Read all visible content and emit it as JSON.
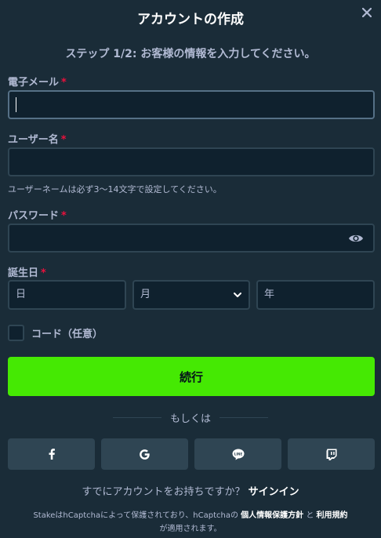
{
  "modal": {
    "title": "アカウントの作成",
    "step_text": "ステップ 1/2: お客様の情報を入力してください。"
  },
  "fields": {
    "email_label": "電子メール",
    "username_label": "ユーザー名",
    "username_hint": "ユーザーネームは必ず3～14文字で設定してください。",
    "password_label": "パスワード",
    "birthdate_label": "誕生日",
    "required_mark": "*",
    "day_placeholder": "日",
    "month_placeholder": "月",
    "year_placeholder": "年"
  },
  "code_checkbox_label": "コード（任意）",
  "continue_label": "続行",
  "or_label": "もしくは",
  "social": [
    "facebook-icon",
    "google-icon",
    "line-icon",
    "twitch-icon"
  ],
  "signin": {
    "prompt": "すでにアカウントをお持ちですか？",
    "link": "サインイン"
  },
  "footer": {
    "part1": "Stake",
    "part2": "はhCaptchaによって保護されており、hCaptchaの",
    "privacy_link": "個人情報保護方針",
    "and": "と",
    "terms_link": "利用規約",
    "part3": "が適用されます。"
  },
  "colors": {
    "background": "#1a2c38",
    "input_bg": "#0f212e",
    "border": "#2f4553",
    "accent_green": "#45e903",
    "required_red": "#e9113c"
  }
}
